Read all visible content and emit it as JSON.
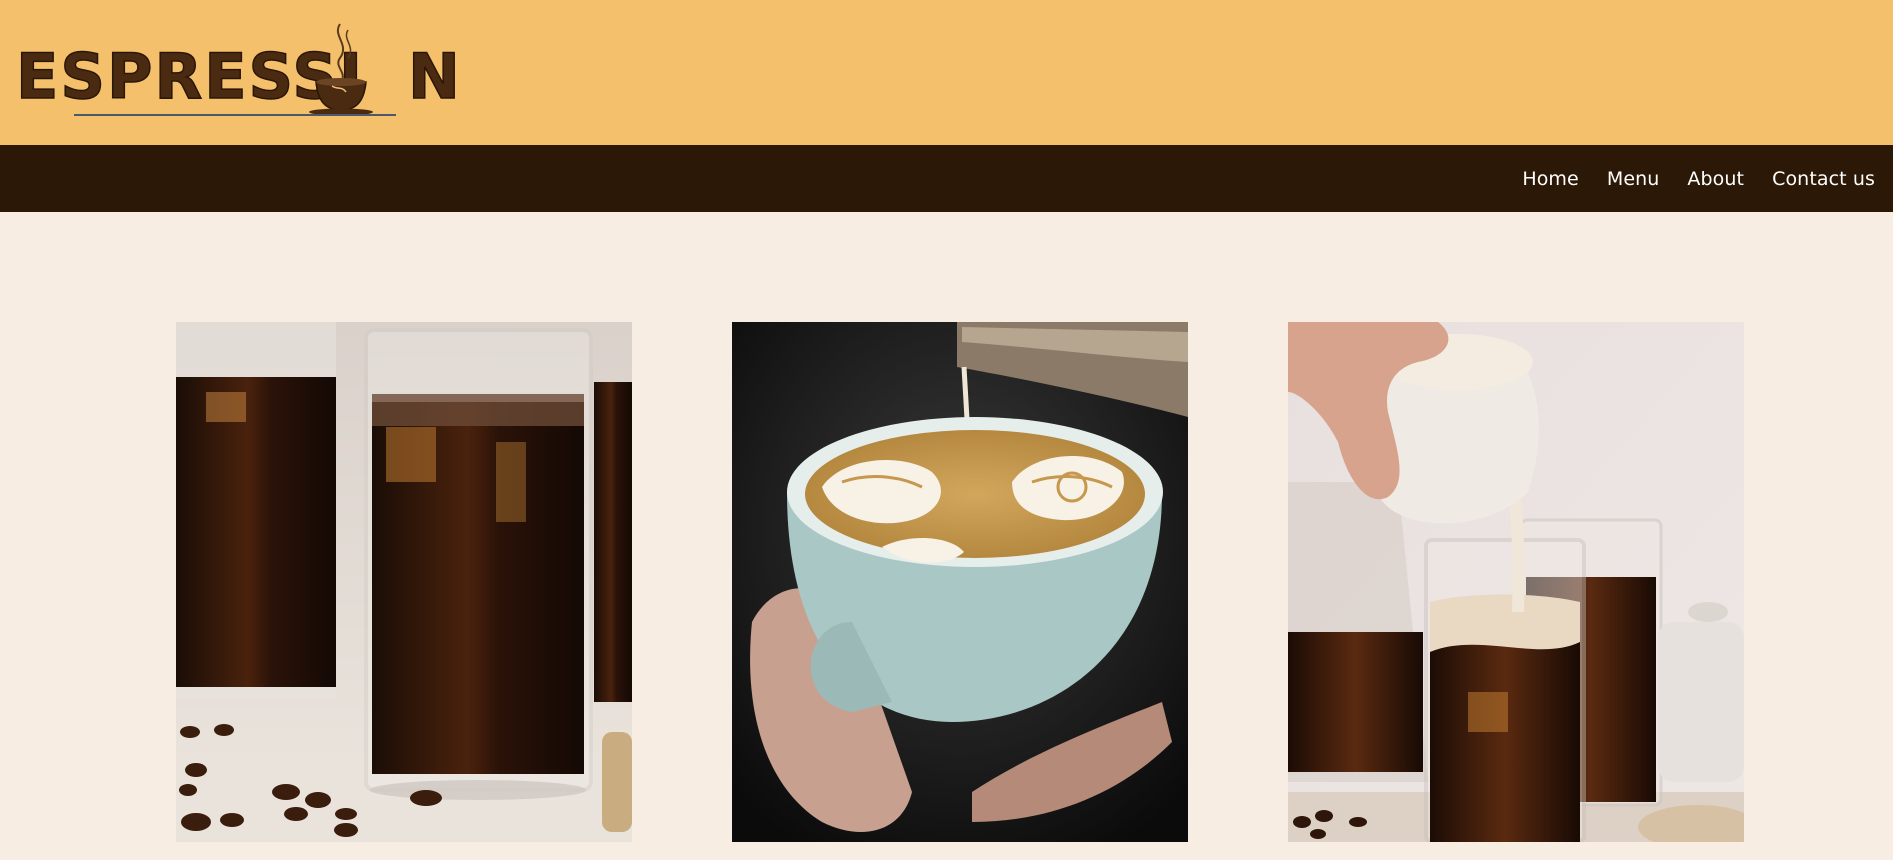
{
  "header": {
    "logo_text_before": "ESPRESSI",
    "logo_text_after": "N",
    "logo_icon": "coffee-cup-icon",
    "background_color": "#f4c06c"
  },
  "nav": {
    "background_color": "#2c1806",
    "items": [
      {
        "label": "Home"
      },
      {
        "label": "Menu"
      },
      {
        "label": "About"
      },
      {
        "label": "Contact us"
      }
    ]
  },
  "gallery": {
    "background_color": "#f7ede3",
    "photos": [
      {
        "subject": "iced-coffee-glasses-photo"
      },
      {
        "subject": "latte-art-pour-photo"
      },
      {
        "subject": "iced-coffee-cream-pour-photo"
      }
    ]
  }
}
